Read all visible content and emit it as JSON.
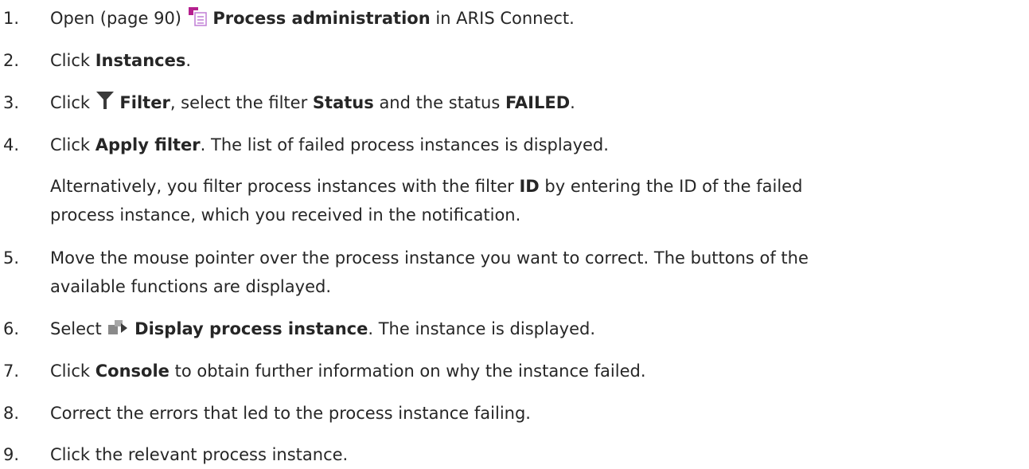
{
  "steps": [
    {
      "number": "1.",
      "prefix": "Open (page 90)",
      "icon": "process-administration-icon",
      "bold": "Process administration",
      "suffix": "in ARIS Connect."
    },
    {
      "number": "2.",
      "prefix": "Click",
      "bold": "Instances",
      "suffix": "."
    },
    {
      "number": "3.",
      "prefix": "Click",
      "icon": "filter-icon",
      "bold": "Filter",
      "mid1": ", select the filter",
      "bold2": "Status",
      "mid2": "and the status",
      "bold3": "FAILED",
      "suffix": "."
    },
    {
      "number": "4.",
      "prefix": "Click",
      "bold": "Apply filter",
      "suffix": ". The list of failed process instances is displayed."
    },
    {
      "number": "5.",
      "line1": "Move the mouse pointer over the process instance you want to correct. The buttons of the",
      "line2": "available functions are displayed."
    },
    {
      "number": "6.",
      "prefix": "Select",
      "icon": "display-process-instance-icon",
      "bold": "Display process instance",
      "suffix": ". The instance is displayed."
    },
    {
      "number": "7.",
      "prefix": "Click",
      "bold": "Console",
      "suffix": "to obtain further information on why the instance failed."
    },
    {
      "number": "8.",
      "text": "Correct the errors that led to the process instance failing."
    },
    {
      "number": "9.",
      "text": "Click the relevant process instance."
    }
  ],
  "note": {
    "line1_prefix": "Alternatively, you filter process instances with the filter",
    "line1_bold": "ID",
    "line1_suffix": "by entering the ID of the failed",
    "line2": "process instance, which you received in the notification."
  },
  "colors": {
    "text": "#262626",
    "icon_magenta": "#b5208e",
    "icon_purple": "#c07fd6",
    "icon_dark": "#3a3a3a",
    "icon_grey": "#8a8a8a"
  }
}
